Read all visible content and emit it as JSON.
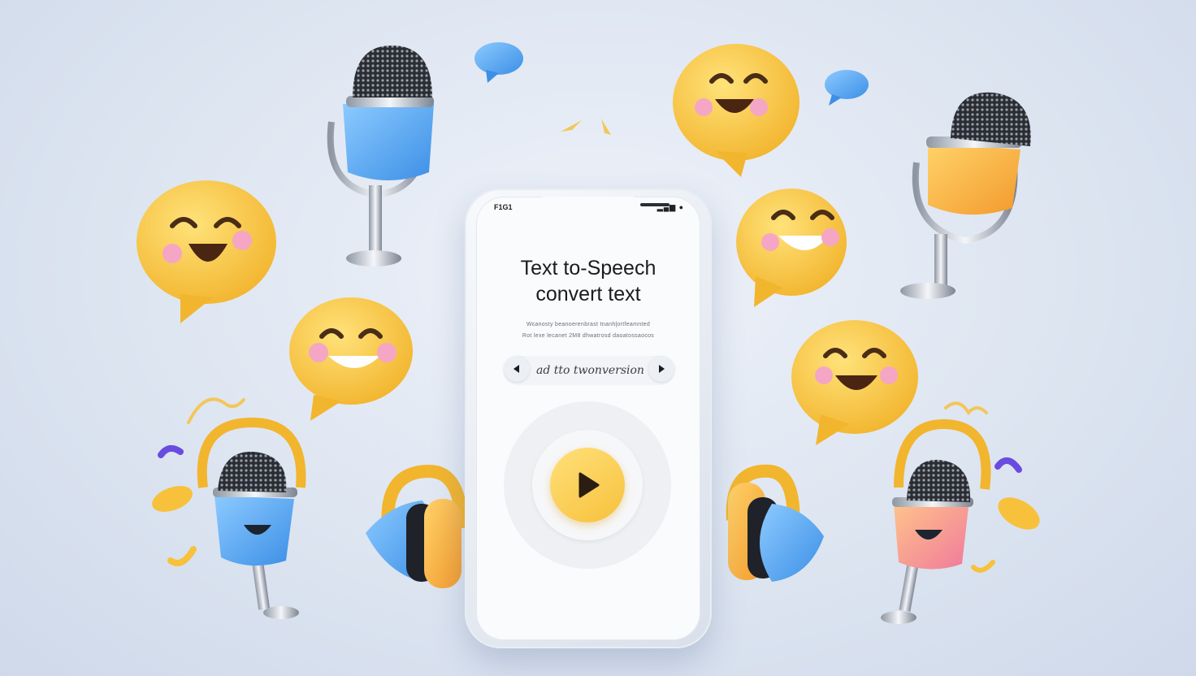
{
  "status": {
    "time": "F1G1",
    "icons": "▂▄▆ ●"
  },
  "app": {
    "title_line1": "Text to-Speech",
    "title_line2": "convert text",
    "desc_line1": "Wɛanosty beanoerenbrast tnanhɭortfeamnted",
    "desc_line2": "Rot lexe lecanet 2M8 dhwatrosd daoatossaocos",
    "control_label": "ad tto twonversion",
    "prev_icon": "triangle-left-icon",
    "next_icon": "triangle-right-icon",
    "play_icon": "play-icon"
  },
  "colors": {
    "accent_yellow": "#f7c13b",
    "accent_blue": "#5aa7ee",
    "background": "#dde5f1"
  }
}
